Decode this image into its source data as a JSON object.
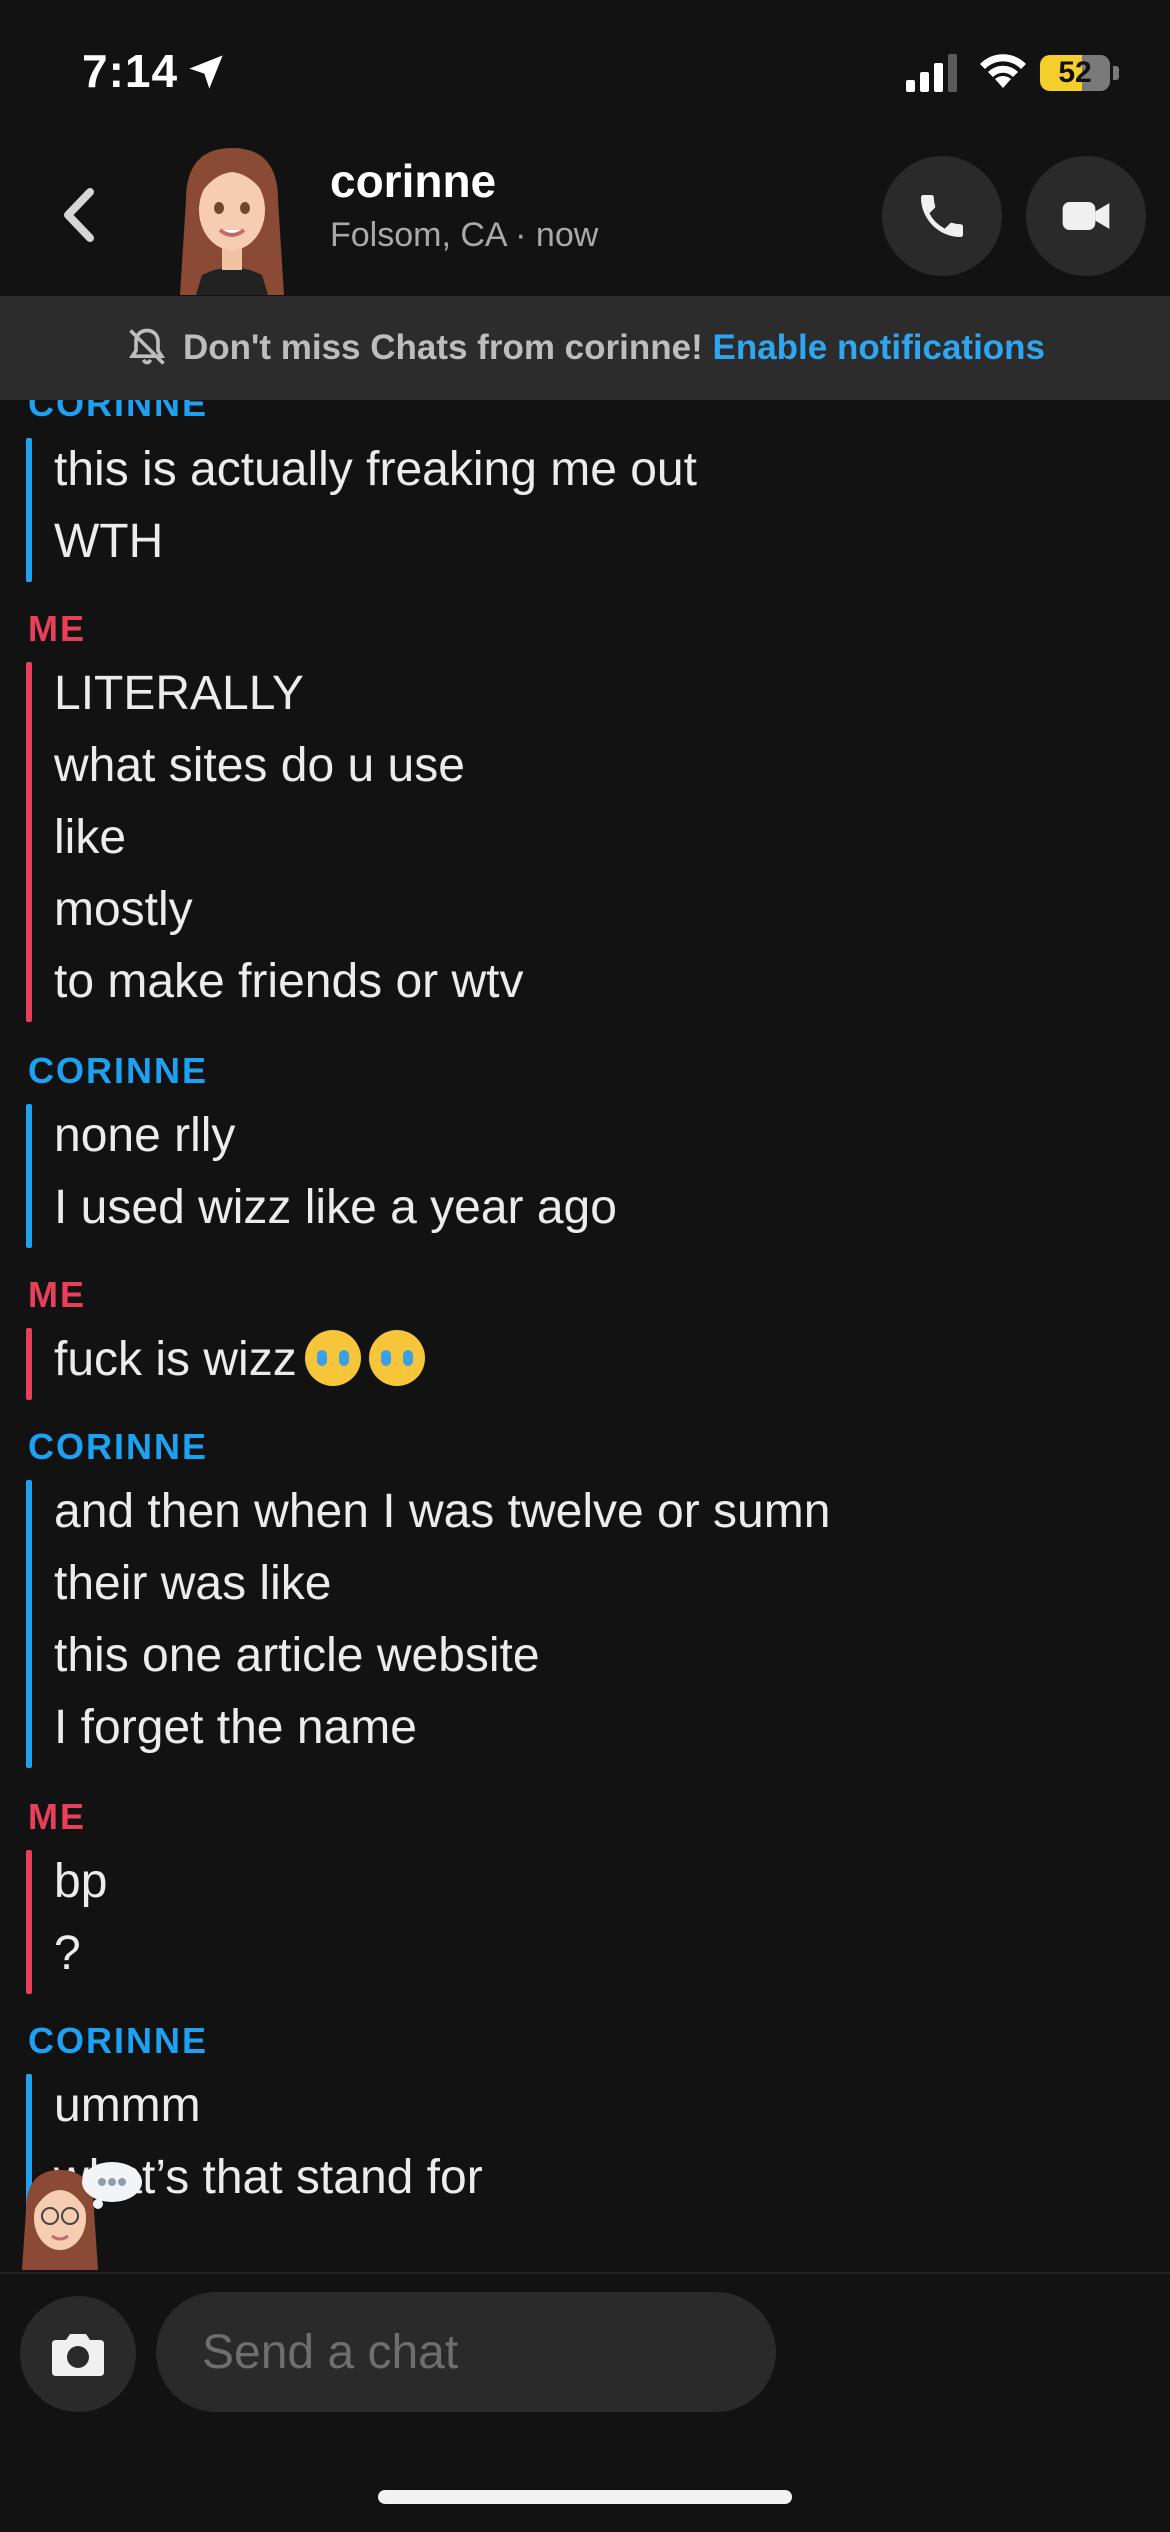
{
  "status_bar": {
    "time": "7:14",
    "battery": "52"
  },
  "header": {
    "contact_name": "corinne",
    "location_status": "Folsom, CA · now"
  },
  "notification": {
    "text": "Don't miss Chats from corinne!",
    "link": "Enable notifications"
  },
  "messages": [
    {
      "sender": "CORINNE",
      "lines": [
        "this is actually freaking me out",
        "WTH"
      ]
    },
    {
      "sender": "ME",
      "lines": [
        "LITERALLY",
        "what sites do u use",
        "like",
        "mostly",
        "to make friends or wtv"
      ]
    },
    {
      "sender": "CORINNE",
      "lines": [
        "none rlly",
        "I used wizz like a year ago"
      ]
    },
    {
      "sender": "ME",
      "lines": [
        "fuck is wizz"
      ]
    },
    {
      "sender": "CORINNE",
      "lines": [
        "and then when I was twelve or sumn",
        "their was like",
        "this one article website",
        "I forget the name"
      ]
    },
    {
      "sender": "ME",
      "lines": [
        "bp",
        "?"
      ]
    },
    {
      "sender": "CORINNE",
      "lines": [
        "ummm",
        "what’s that stand for"
      ]
    }
  ],
  "composer": {
    "placeholder": "Send a chat"
  },
  "colors": {
    "corinne_accent": "#1da1f2",
    "me_accent": "#e8405b",
    "notif_link": "#2ea6f2",
    "battery": "#f4cf2c"
  },
  "icons": [
    "location-arrow-icon",
    "signal-icon",
    "wifi-icon",
    "battery-icon",
    "back-chevron-icon",
    "phone-icon",
    "video-camera-icon",
    "bell-slash-icon",
    "crying-emoji-icon",
    "camera-icon"
  ]
}
